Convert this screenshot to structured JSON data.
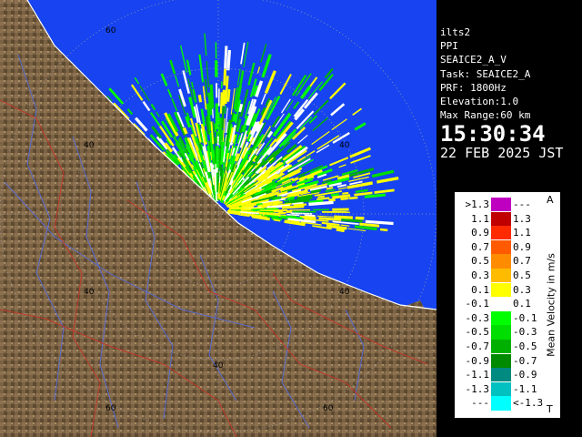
{
  "radar": {
    "info": {
      "site": "ilts2",
      "mode": "PPI",
      "product": "SEAICE2_A_V",
      "task": "Task: SEAICE2_A",
      "prf": "PRF: 1800Hz",
      "elevation": "Elevation:1.0",
      "max_range": "Max Range:60 km",
      "time": "15:30:34",
      "date": "22 FEB 2025 JST"
    },
    "ring_labels": [
      "60",
      "40",
      "40",
      "40",
      "40",
      "60",
      "60"
    ],
    "colors": {
      "sea": "#1744f0",
      "land": "#7a6243",
      "land_dark": "#4b3a25",
      "land_light": "#a88c62",
      "coast": "#ffffff",
      "rivers": "#5a6cd0",
      "borders": "#c0392b",
      "rings": "#a0a0a0"
    },
    "legend": {
      "title": "Mean Velocity in m/s",
      "top_marker": "A",
      "bottom_marker": "T",
      "rows": [
        {
          "left": ">1.3",
          "right": "---",
          "color": "#c000c0"
        },
        {
          "left": "1.1",
          "right": "1.3",
          "color": "#c00000"
        },
        {
          "left": "0.9",
          "right": "1.1",
          "color": "#ff2a00"
        },
        {
          "left": "0.7",
          "right": "0.9",
          "color": "#ff5a00"
        },
        {
          "left": "0.5",
          "right": "0.7",
          "color": "#ff8c00"
        },
        {
          "left": "0.3",
          "right": "0.5",
          "color": "#ffbb00"
        },
        {
          "left": "0.1",
          "right": "0.3",
          "color": "#ffff00"
        },
        {
          "left": "-0.1",
          "right": "0.1",
          "color": "#ffffff"
        },
        {
          "left": "-0.3",
          "right": "-0.1",
          "color": "#00ff00"
        },
        {
          "left": "-0.5",
          "right": "-0.3",
          "color": "#00dd00"
        },
        {
          "left": "-0.7",
          "right": "-0.5",
          "color": "#00b000"
        },
        {
          "left": "-0.9",
          "right": "-0.7",
          "color": "#008a00"
        },
        {
          "left": "-1.1",
          "right": "-0.9",
          "color": "#008a80"
        },
        {
          "left": "-1.3",
          "right": "-1.1",
          "color": "#00c0c0"
        },
        {
          "left": "---",
          "right": "<-1.3",
          "color": "#00ffff"
        }
      ]
    }
  }
}
